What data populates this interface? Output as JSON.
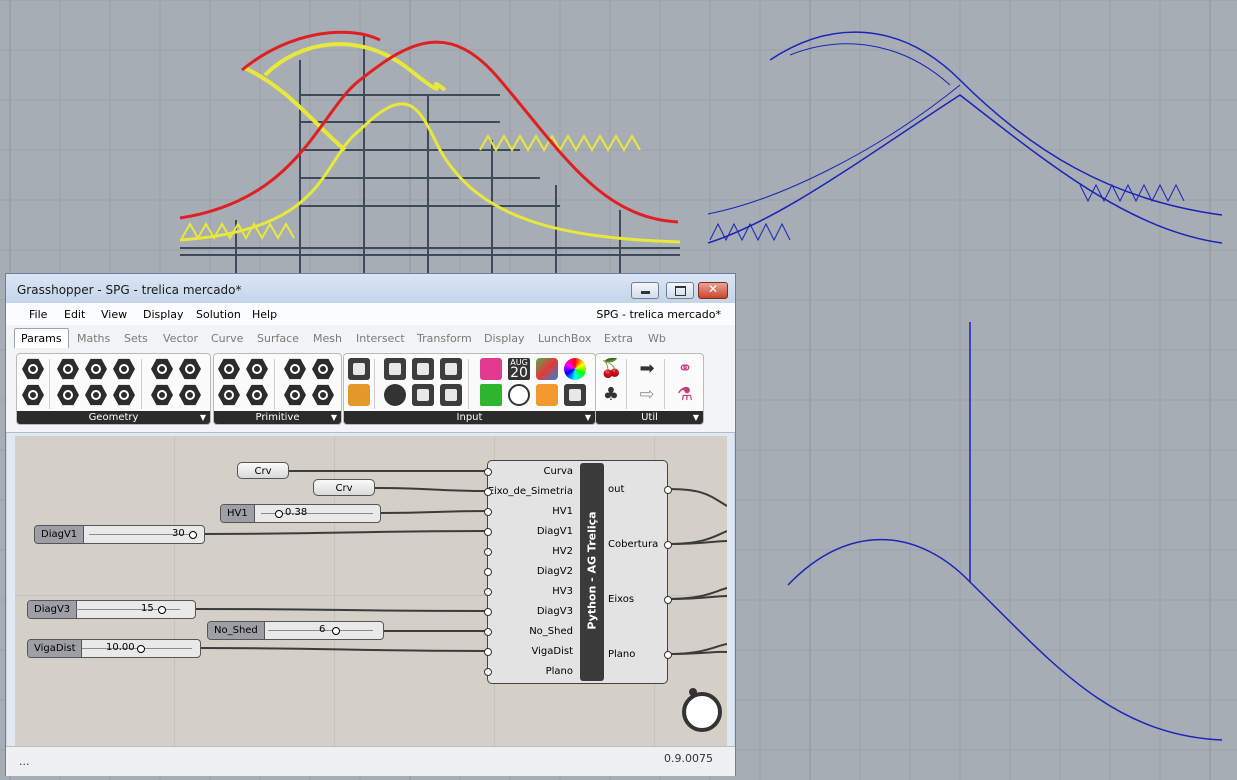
{
  "window": {
    "title": "Grasshopper - SPG - trelica mercado*",
    "document": "SPG - trelica mercado*"
  },
  "menu": [
    "File",
    "Edit",
    "View",
    "Display",
    "Solution",
    "Help"
  ],
  "tabs": [
    "Params",
    "Maths",
    "Sets",
    "Vector",
    "Curve",
    "Surface",
    "Mesh",
    "Intersect",
    "Transform",
    "Display",
    "LunchBox",
    "Extra",
    "Wb"
  ],
  "ribbon": {
    "groups": [
      "Geometry",
      "Primitive",
      "Input",
      "Util"
    ],
    "input_date": {
      "month": "AUG",
      "day": "20"
    }
  },
  "canvas": {
    "curve_params": [
      "Crv",
      "Crv"
    ],
    "sliders": [
      {
        "name": "HV1",
        "value": "0.38"
      },
      {
        "name": "DiagV1",
        "value": "30"
      },
      {
        "name": "DiagV3",
        "value": "15"
      },
      {
        "name": "No_Shed",
        "value": "6"
      },
      {
        "name": "VigaDist",
        "value": "10.00"
      }
    ],
    "python_component": {
      "name": "Python - AG Treliça",
      "inputs": [
        "Curva",
        "Eixo_de_Simetria",
        "HV1",
        "DiagV1",
        "HV2",
        "DiagV2",
        "HV3",
        "DiagV3",
        "No_Shed",
        "VigaDist",
        "Plano"
      ],
      "outputs": [
        "out",
        "Cobertura",
        "Eixos",
        "Plano"
      ]
    }
  },
  "status": {
    "left": "...",
    "version": "0.9.0075"
  },
  "colors": {
    "viewport_bg": "#a7adb5",
    "selected_curve": "#e02020",
    "preview": "#f5f54a",
    "wire_blue": "#1a24b8"
  }
}
